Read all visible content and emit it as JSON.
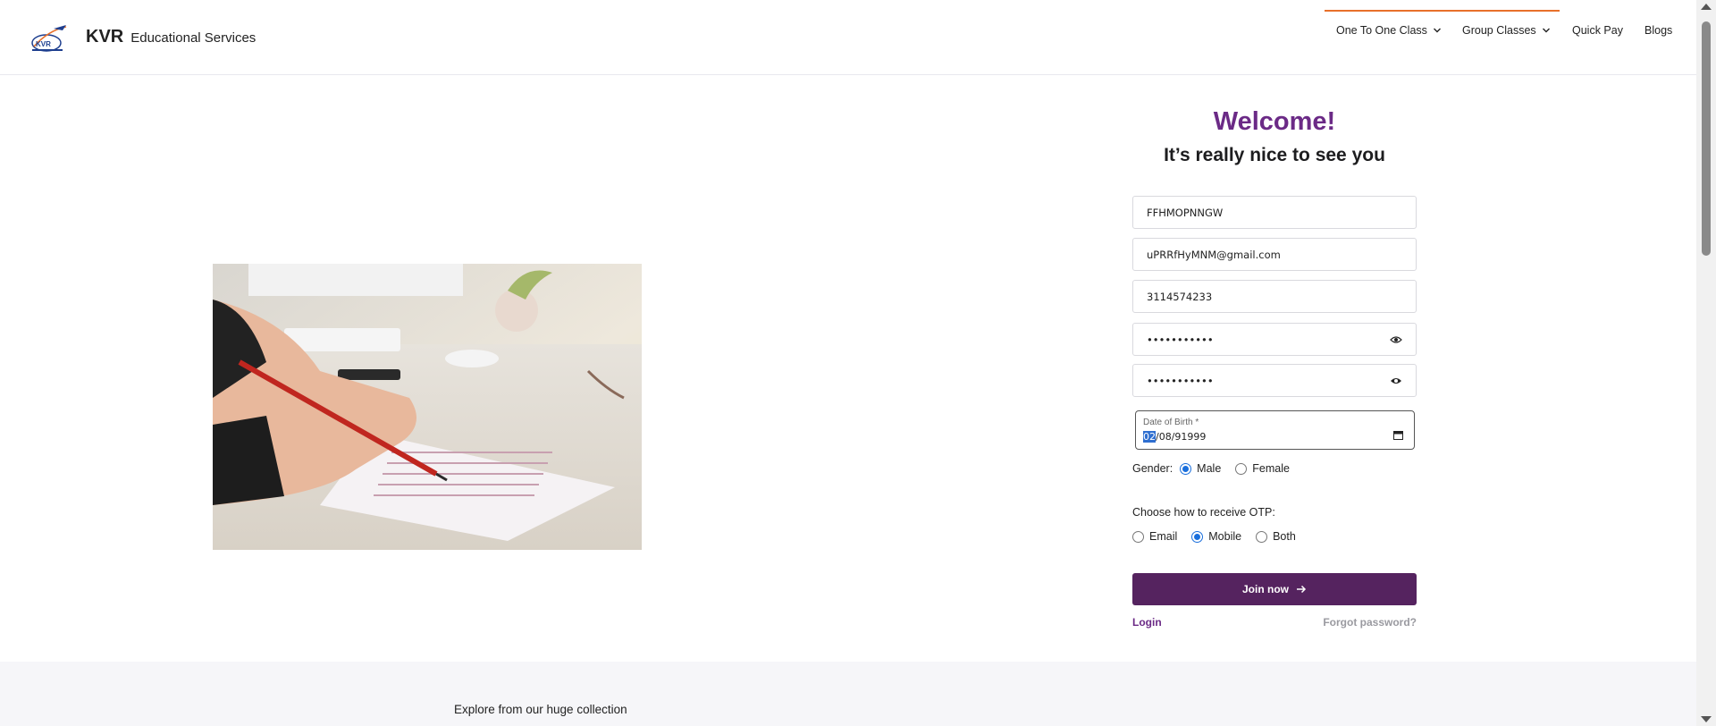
{
  "brand": {
    "name": "KVR",
    "tagline": "Educational Services",
    "logo": "kvr-logo"
  },
  "nav": {
    "items": [
      {
        "label": "One To One Class",
        "has_dropdown": true,
        "active": true
      },
      {
        "label": "Group Classes",
        "has_dropdown": true
      },
      {
        "label": "Quick Pay"
      },
      {
        "label": "Blogs"
      }
    ]
  },
  "hero": {
    "image": "student-writing-answer-sheet"
  },
  "form": {
    "welcome": "Welcome!",
    "subtitle": "It’s really nice to see you",
    "name_value": "FFHMOPNNGW",
    "email_value": "uPRRfHyMNM@gmail.com",
    "phone_value": "3114574233",
    "password_value": "•••••••••••",
    "confirm_password_value": "•••••••••••",
    "dob": {
      "label": "Date of Birth *",
      "value_selected": "02",
      "value_rest": "/08/91999"
    },
    "gender": {
      "label": "Gender:",
      "options": [
        "Male",
        "Female"
      ],
      "selected": "Male"
    },
    "otp": {
      "label": "Choose how to receive OTP:",
      "options": [
        "Email",
        "Mobile",
        "Both"
      ],
      "selected": "Mobile"
    },
    "submit_label": "Join now",
    "login_label": "Login",
    "forgot_label": "Forgot password?"
  },
  "footer_band": {
    "text": "Explore from our huge collection"
  },
  "colors": {
    "accent": "#6b2a86",
    "button": "#55235f",
    "nav_active": "#e8702a",
    "radio": "#1a6fdc"
  }
}
